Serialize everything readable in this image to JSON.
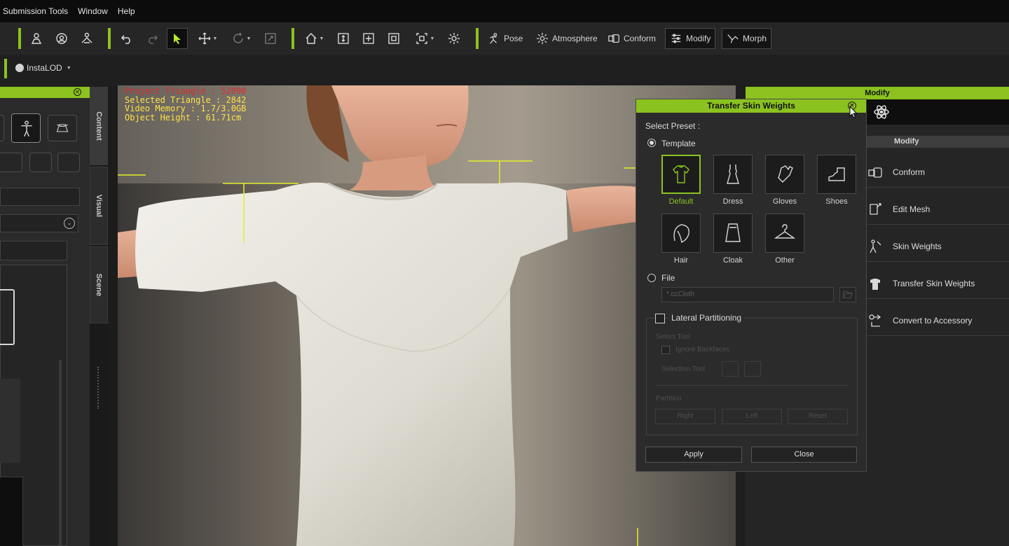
{
  "menu": [
    "Submission Tools",
    "Window",
    "Help"
  ],
  "toolbar": {
    "pose": "Pose",
    "atmosphere": "Atmosphere",
    "conform": "Conform",
    "modify": "Modify",
    "morph": "Morph"
  },
  "bar2": {
    "instalod": "InstaLOD"
  },
  "side_tabs": [
    "Content",
    "Visual",
    "Scene"
  ],
  "viewport": {
    "stats": {
      "project_triangle": "Project Triangle : 52090",
      "selected_triangle": "Selected Triangle : 2842",
      "video_memory": "Video Memory : 1.7/3.0GB",
      "object_height": "Object Height : 61.71cm"
    }
  },
  "modify_panel": {
    "title": "Modify",
    "section": "Modify",
    "items": [
      "Conform",
      "Edit Mesh",
      "Skin Weights",
      "Transfer Skin Weights",
      "Convert to Accessory"
    ]
  },
  "dialog": {
    "title": "Transfer Skin Weights",
    "select_preset": "Select Preset :",
    "template_label": "Template",
    "templates": [
      "Default",
      "Dress",
      "Gloves",
      "Shoes",
      "Hair",
      "Cloak",
      "Other"
    ],
    "file_label": "File",
    "file_placeholder": "*.ccCloth",
    "lateral_partitioning": "Lateral Partitioning",
    "select_tool": "Select Tool",
    "ignore_backfaces": "Ignore Backfaces",
    "selection_tool": "Selection Tool",
    "partition": "Partition",
    "right": "Right",
    "left": "Left",
    "reset": "Reset",
    "apply": "Apply",
    "close": "Close"
  },
  "colors": {
    "accent": "#8bc21f",
    "stats_text": "#ffe14a",
    "stats_alert": "#e02a2a"
  }
}
